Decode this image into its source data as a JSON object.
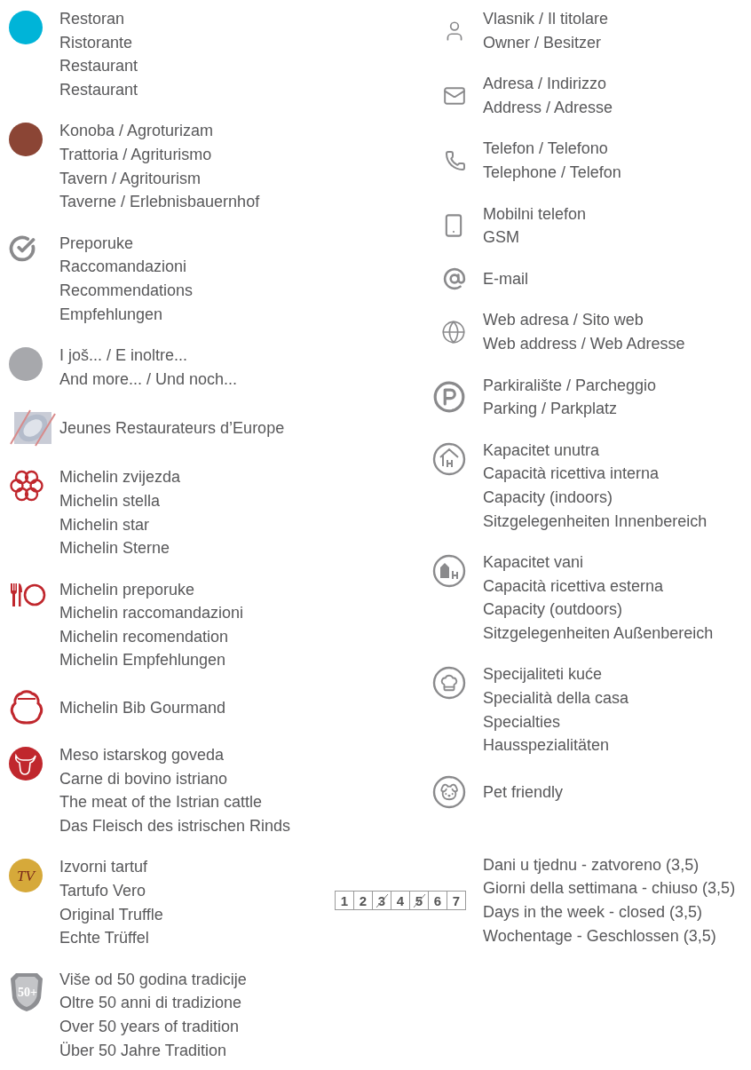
{
  "left_entries": [
    {
      "kind": "dot",
      "color": "#00b4d8",
      "lines": [
        "Restoran",
        "Ristorante",
        "Restaurant",
        "Restaurant"
      ]
    },
    {
      "kind": "dot",
      "color": "#8b4535",
      "lines": [
        "Konoba / Agroturizam",
        "Trattoria / Agriturismo",
        "Tavern / Agritourism",
        "Taverne / Erlebnisbauernhof"
      ]
    },
    {
      "kind": "check",
      "lines": [
        "Preporuke",
        "Raccomandazioni",
        "Recommendations",
        "Empfehlungen"
      ]
    },
    {
      "kind": "dot",
      "color": "#a7a8ac",
      "lines": [
        "I još... / E inoltre...",
        "And more... / Und noch..."
      ]
    },
    {
      "kind": "logo",
      "lines": [
        "Jeunes Restaurateurs d’Europe"
      ]
    },
    {
      "kind": "star",
      "lines": [
        "Michelin zvijezda",
        "Michelin stella",
        "Michelin star",
        "Michelin Sterne"
      ]
    },
    {
      "kind": "cutlery",
      "lines": [
        "Michelin preporuke",
        "Michelin raccomandazioni",
        "Michelin recomendation",
        "Michelin Empfehlungen"
      ]
    },
    {
      "kind": "mascot",
      "lines": [
        "Michelin Bib Gourmand"
      ]
    },
    {
      "kind": "bull",
      "lines": [
        "Meso istarskog goveda",
        "Carne di bovino istriano",
        "The meat of the Istrian cattle",
        "Das Fleisch des istrischen Rinds"
      ]
    },
    {
      "kind": "badge",
      "badge_text": "TV",
      "lines": [
        "Izvorni tartuf",
        "Tartufo Vero",
        "Original Truffle",
        "Echte Trüffel"
      ]
    },
    {
      "kind": "shield",
      "badge_text": "50+",
      "lines": [
        "Više od 50 godina tradicije",
        "Oltre 50 anni di tradizione",
        "Over 50 years of tradition",
        "Über 50 Jahre Tradition"
      ]
    }
  ],
  "right_entries": [
    {
      "kind": "person",
      "lines": [
        "Vlasnik / Il titolare",
        "Owner / Besitzer"
      ]
    },
    {
      "kind": "mail",
      "lines": [
        "Adresa / Indirizzo",
        "Address / Adresse"
      ]
    },
    {
      "kind": "phone",
      "lines": [
        "Telefon / Telefono",
        "Telephone / Telefon"
      ]
    },
    {
      "kind": "mobile",
      "lines": [
        "Mobilni telefon",
        "GSM"
      ]
    },
    {
      "kind": "at",
      "lines": [
        "E-mail"
      ]
    },
    {
      "kind": "globe",
      "lines": [
        "Web adresa / Sito web",
        "Web address / Web Adresse"
      ]
    },
    {
      "kind": "parking",
      "lines": [
        "Parkiralište / Parcheggio",
        "Parking / Parkplatz"
      ]
    },
    {
      "kind": "indoor",
      "lines": [
        "Kapacitet unutra",
        "Capacità ricettiva interna",
        "Capacity (indoors)",
        "Sitzgelegenheiten Innenbereich"
      ]
    },
    {
      "kind": "outdoor",
      "lines": [
        "Kapacitet vani",
        "Capacità ricettiva esterna",
        "Capacity (outdoors)",
        "Sitzgelegenheiten Außenbereich"
      ]
    },
    {
      "kind": "chef",
      "lines": [
        "Specijaliteti kuće",
        "Specialità della casa",
        "Specialties",
        "Hausspezialitäten"
      ]
    },
    {
      "kind": "dog",
      "lines": [
        "Pet friendly"
      ]
    },
    {
      "kind": "days",
      "days": [
        {
          "label": "1",
          "closed": false
        },
        {
          "label": "2",
          "closed": false
        },
        {
          "label": "3",
          "closed": true
        },
        {
          "label": "4",
          "closed": false
        },
        {
          "label": "5",
          "closed": true
        },
        {
          "label": "6",
          "closed": false
        },
        {
          "label": "7",
          "closed": false
        }
      ],
      "lines": [
        "Dani u tjednu - zatvoreno (3,5)",
        "Giorni della settimana - chiuso (3,5)",
        "Days in the week - closed (3,5)",
        "Wochentage - Geschlossen (3,5)"
      ]
    }
  ]
}
